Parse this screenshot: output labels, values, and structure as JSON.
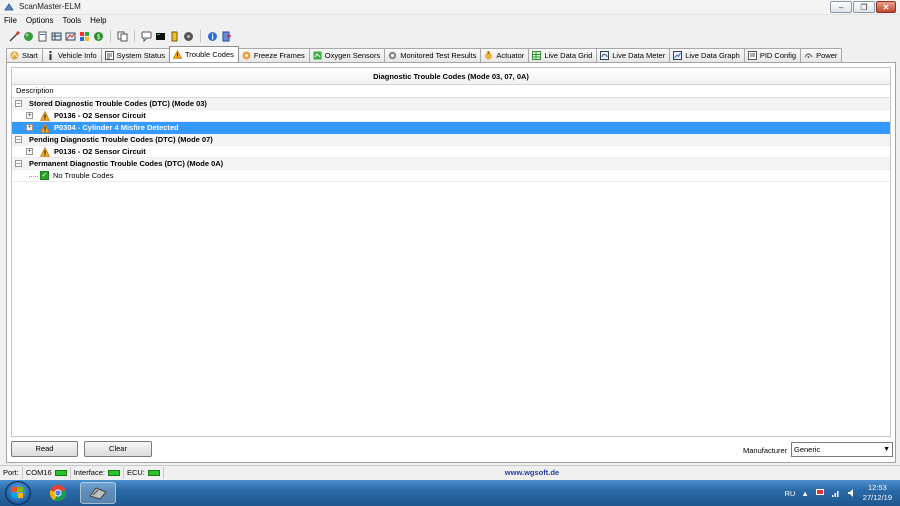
{
  "window": {
    "title": "ScanMaster-ELM"
  },
  "menu": [
    "File",
    "Options",
    "Tools",
    "Help"
  ],
  "tabs": [
    {
      "label": "Start",
      "icon": "start-icon"
    },
    {
      "label": "Vehicle Info",
      "icon": "info-icon"
    },
    {
      "label": "System Status",
      "icon": "status-icon"
    },
    {
      "label": "Trouble Codes",
      "icon": "warning-icon",
      "active": true
    },
    {
      "label": "Freeze Frames",
      "icon": "freeze-icon"
    },
    {
      "label": "Oxygen Sensors",
      "icon": "oxygen-icon"
    },
    {
      "label": "Monitored Test Results",
      "icon": "gear-icon"
    },
    {
      "label": "Actuator",
      "icon": "actuator-icon"
    },
    {
      "label": "Live Data Grid",
      "icon": "grid-icon"
    },
    {
      "label": "Live Data Meter",
      "icon": "meter-icon"
    },
    {
      "label": "Live Data Graph",
      "icon": "graph-icon"
    },
    {
      "label": "PID Config",
      "icon": "pid-icon"
    },
    {
      "label": "Power",
      "icon": "power-icon"
    }
  ],
  "dtc": {
    "header": "Diagnostic Trouble Codes (Mode 03, 07, 0A)",
    "column": "Description",
    "stored_group": "Stored Diagnostic Trouble Codes (DTC) (Mode 03)",
    "stored": [
      "P0136 - O2 Sensor Circuit",
      "P0304 - Cylinder 4 Misfire Detected"
    ],
    "pending_group": "Pending Diagnostic Trouble Codes (DTC) (Mode 07)",
    "pending": [
      "P0136 - O2 Sensor Circuit"
    ],
    "permanent_group": "Permanent Diagnostic Trouble Codes (DTC) (Mode 0A)",
    "permanent": [
      "No Trouble Codes"
    ]
  },
  "buttons": {
    "read": "Read",
    "clear": "Clear"
  },
  "manufacturer": {
    "label": "Manufacturer",
    "value": "Generic"
  },
  "status": {
    "port_label": "Port:",
    "port_value": "COM16",
    "interface_label": "Interface:",
    "ecu_label": "ECU:",
    "link": "www.wgsoft.de"
  },
  "taskbar": {
    "lang": "RU",
    "time": "12:53",
    "date": "27/12/19"
  },
  "colors": {
    "selection": "#3399ff",
    "led": "#2cc22c",
    "warning": "#f5a623"
  }
}
